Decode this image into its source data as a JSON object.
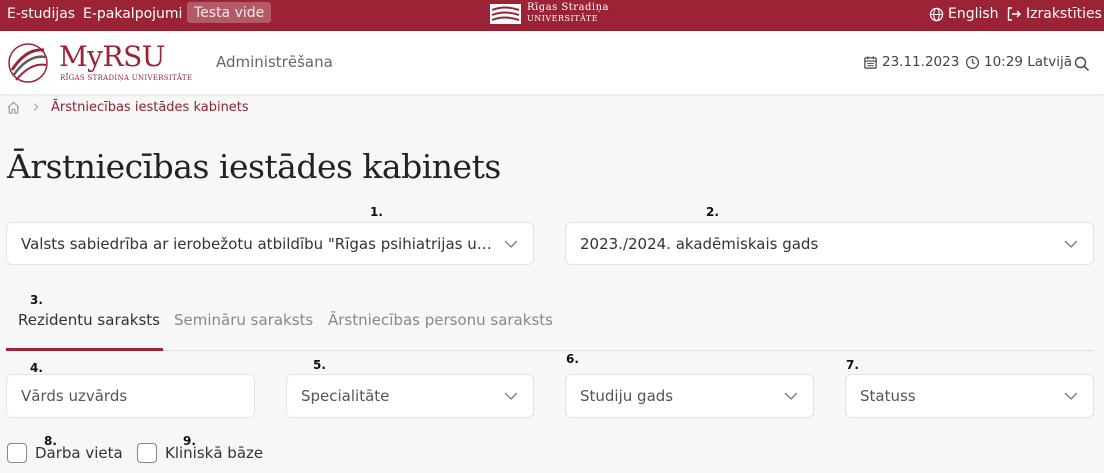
{
  "topbar": {
    "links": [
      "E-studijas",
      "E-pakalpojumi"
    ],
    "test_badge": "Testa vide",
    "university_line1": "Rīgas Stradiņa",
    "university_line2": "universitāte",
    "language": "English",
    "logout": "Izrakstīties"
  },
  "header": {
    "brand": "MyRSU",
    "brand_sub": "Rīgas Stradiņa universitāte",
    "nav_admin": "Administrēšana",
    "date": "23.11.2023",
    "time": "10:29 Latvijā"
  },
  "breadcrumb": {
    "current": "Ārstniecības iestādes kabinets"
  },
  "page_title": "Ārstniecības iestādes kabinets",
  "markers": [
    "1.",
    "2.",
    "3.",
    "4.",
    "5.",
    "6.",
    "7.",
    "8.",
    "9."
  ],
  "selectors": {
    "institution": "Valsts sabiedrība ar ierobežotu atbildību \"Rīgas psihiatrijas un narkoloģijas centrs\"",
    "academic_year": "2023./2024. akadēmiskais gads"
  },
  "tabs": [
    {
      "label": "Rezidentu saraksts",
      "active": true
    },
    {
      "label": "Semināru saraksts",
      "active": false
    },
    {
      "label": "Ārstniecības personu saraksts",
      "active": false
    }
  ],
  "filters": {
    "name_placeholder": "Vārds uzvārds",
    "specialty": "Specialitāte",
    "study_year": "Studiju gads",
    "status": "Statuss"
  },
  "checkboxes": {
    "workplace": "Darba vieta",
    "clinical_base": "Kliniskā bāze"
  },
  "colors": {
    "brand": "#9b2335"
  },
  "icons": [
    "globe-icon",
    "logout-icon",
    "calendar-icon",
    "clock-icon",
    "search-icon",
    "home-icon",
    "chevron-right-icon",
    "chevron-down-icon"
  ]
}
